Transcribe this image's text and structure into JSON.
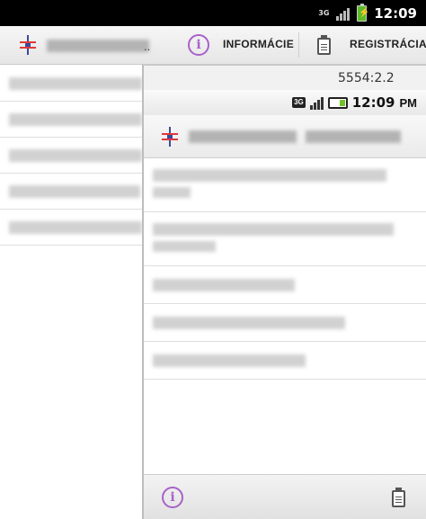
{
  "status_bar": {
    "network": "3G",
    "time": "12:09",
    "icons": [
      "network-3g-icon",
      "signal-icon",
      "battery-icon"
    ]
  },
  "action_bar": {
    "app_title": "",
    "title_ellipsis": "..",
    "info_label": "INFORMÁCIE",
    "register_label": "REGISTRÁCIA",
    "icons": [
      "app-logo-icon",
      "info-icon",
      "clipboard-icon"
    ]
  },
  "back_list": {
    "items": [
      "",
      "",
      "",
      "",
      ""
    ]
  },
  "phone_preview": {
    "window_title": "5554:2.2",
    "status": {
      "network": "3G",
      "time": "12:09",
      "ampm": "PM"
    },
    "action_bar": {
      "app_title": ""
    },
    "list": {
      "items": [
        "",
        "",
        "",
        "",
        ""
      ]
    },
    "bottom_bar": {
      "icons": [
        "info-icon",
        "clipboard-icon"
      ]
    }
  },
  "colors": {
    "accent_purple": "#a861c9",
    "logo_red": "#e03a3a",
    "logo_blue": "#3a4a9a",
    "battery_green": "#5dbb2b"
  }
}
